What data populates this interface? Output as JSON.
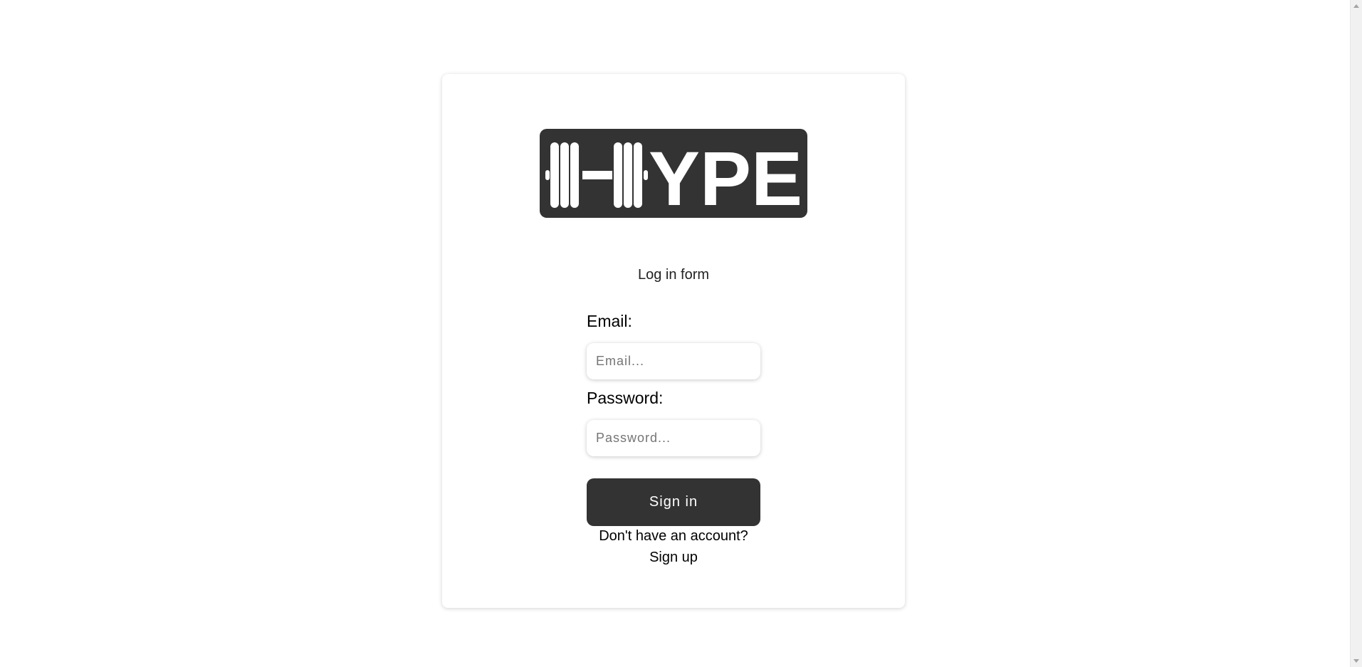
{
  "logo": {
    "text": "YPE",
    "background": "#333333",
    "foreground": "#ffffff",
    "icon": "barbell-icon"
  },
  "form": {
    "title": "Log in form",
    "email_label": "Email:",
    "email_placeholder": "Email...",
    "email_value": "",
    "password_label": "Password:",
    "password_placeholder": "Password...",
    "password_value": "",
    "submit_label": "Sign in",
    "no_account_text": "Don't have an account?",
    "signup_label": "Sign up"
  },
  "colors": {
    "page_background": "#ffffff",
    "button_background": "#333333",
    "button_text": "#ffffff"
  }
}
